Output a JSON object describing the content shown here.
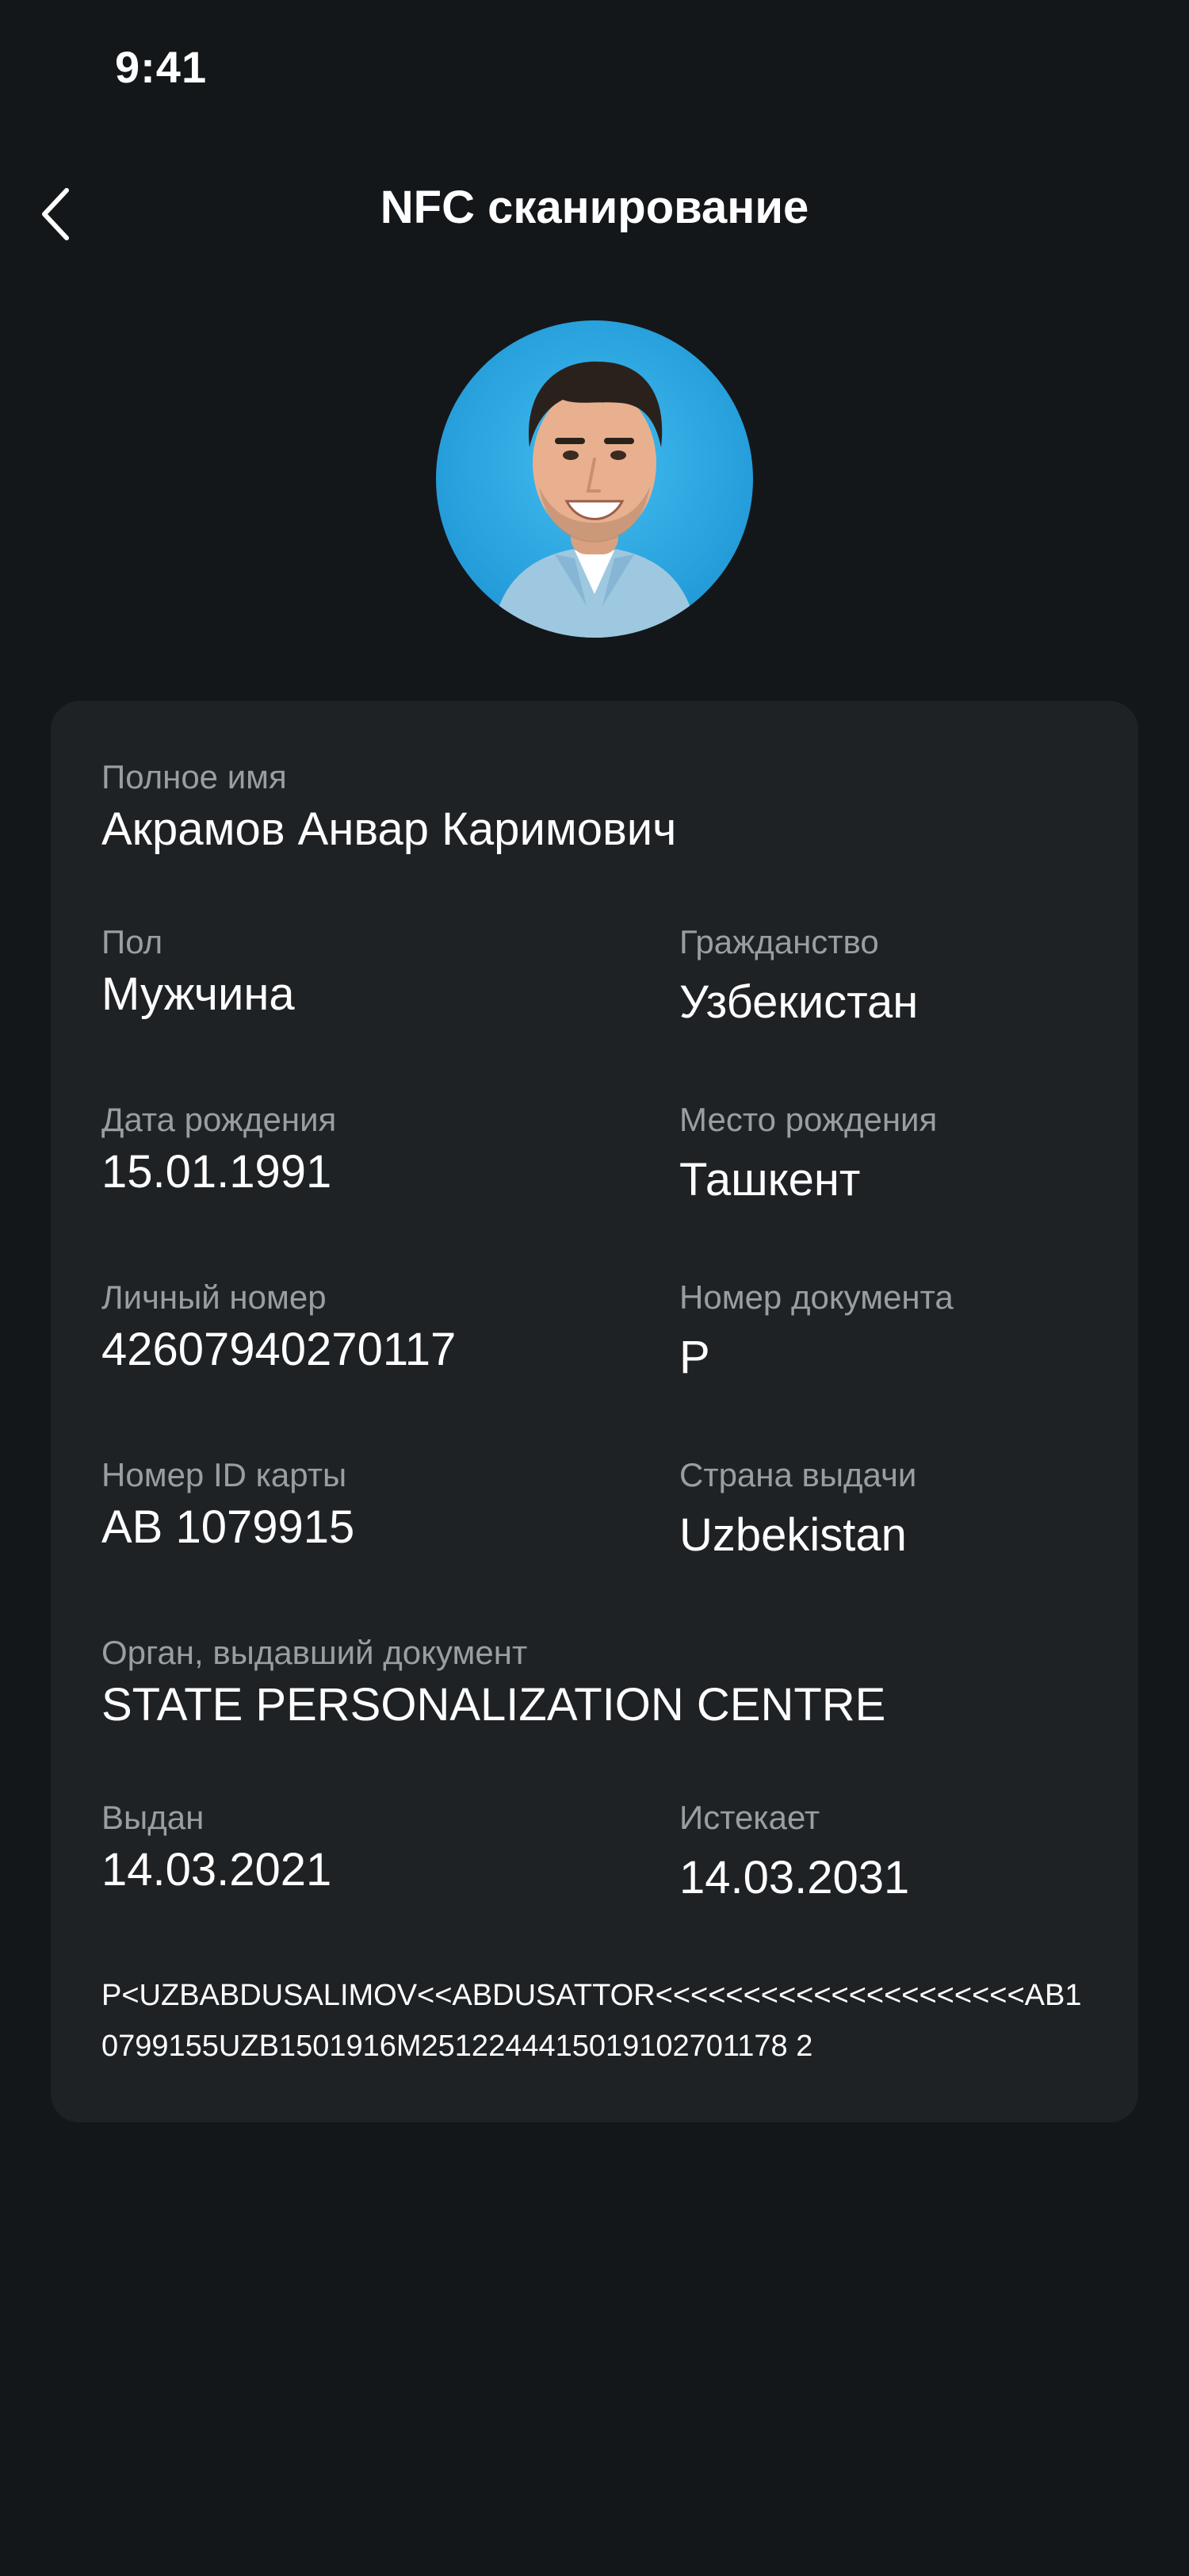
{
  "status_bar": {
    "time": "9:41"
  },
  "header": {
    "title": "NFC сканирование",
    "back_icon": "chevron-left-icon"
  },
  "profile": {
    "avatar_icon": "user-photo"
  },
  "details": {
    "full_name": {
      "label": "Полное имя",
      "value": "Акрамов Анвар Каримович"
    },
    "gender": {
      "label": "Пол",
      "value": "Мужчина"
    },
    "citizenship": {
      "label": "Гражданство",
      "value": "Узбекистан"
    },
    "birth_date": {
      "label": "Дата рождения",
      "value": "15.01.1991"
    },
    "birth_place": {
      "label": "Место рождения",
      "value": "Ташкент"
    },
    "personal_number": {
      "label": "Личный номер",
      "value": "42607940270117"
    },
    "document_number": {
      "label": "Номер документа",
      "value": "P"
    },
    "id_card_number": {
      "label": "Номер ID карты",
      "value": "AB 1079915"
    },
    "issuing_country": {
      "label": "Страна выдачи",
      "value": "Uzbekistan"
    },
    "issuing_authority": {
      "label": "Орган, выдавший документ",
      "value": "STATE PERSONALIZATION CENTRE"
    },
    "issued": {
      "label": "Выдан",
      "value": "14.03.2021"
    },
    "expires": {
      "label": "Истекает",
      "value": "14.03.2031"
    }
  },
  "mrz": {
    "line1": "P<UZBABDUSALIMOV<<ABDUSATTOR<<<<<<<<<<<<<<<<<<<<<AB1",
    "line2": "0799155UZB1501916M2512244415019102701178 2"
  },
  "colors": {
    "background": "#141719",
    "card": "#1f2225",
    "label": "#9a9ea3",
    "text": "#ffffff",
    "avatar_bg": "#2aa9e6"
  }
}
